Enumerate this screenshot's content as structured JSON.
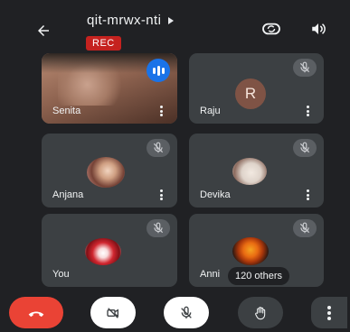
{
  "header": {
    "meeting_code": "qit-mrwx-nti",
    "recording_label": "REC"
  },
  "icons": {
    "back": "arrow-left-icon",
    "switch_camera": "switch-camera-icon",
    "speaker": "speaker-icon",
    "mic_off": "mic-off-icon",
    "video_off": "video-off-icon",
    "raise_hand": "hand-icon",
    "end_call": "end-call-icon",
    "more": "more-vertical-icon"
  },
  "participants": [
    {
      "name": "Senita",
      "avatar": "video",
      "status": "speaking"
    },
    {
      "name": "Raju",
      "avatar": "R",
      "status": "muted"
    },
    {
      "name": "Anjana",
      "avatar": "photo",
      "status": "muted"
    },
    {
      "name": "Devika",
      "avatar": "photo",
      "status": "muted"
    },
    {
      "name": "You",
      "avatar": "photo",
      "status": "muted"
    },
    {
      "name": "Anni",
      "avatar": "photo",
      "status": "muted"
    }
  ],
  "others_count_label": "120 others",
  "colors": {
    "background": "#202124",
    "tile": "#3c4043",
    "record": "#c5221f",
    "end_call": "#ea4335",
    "speaking": "#1a73e8"
  }
}
